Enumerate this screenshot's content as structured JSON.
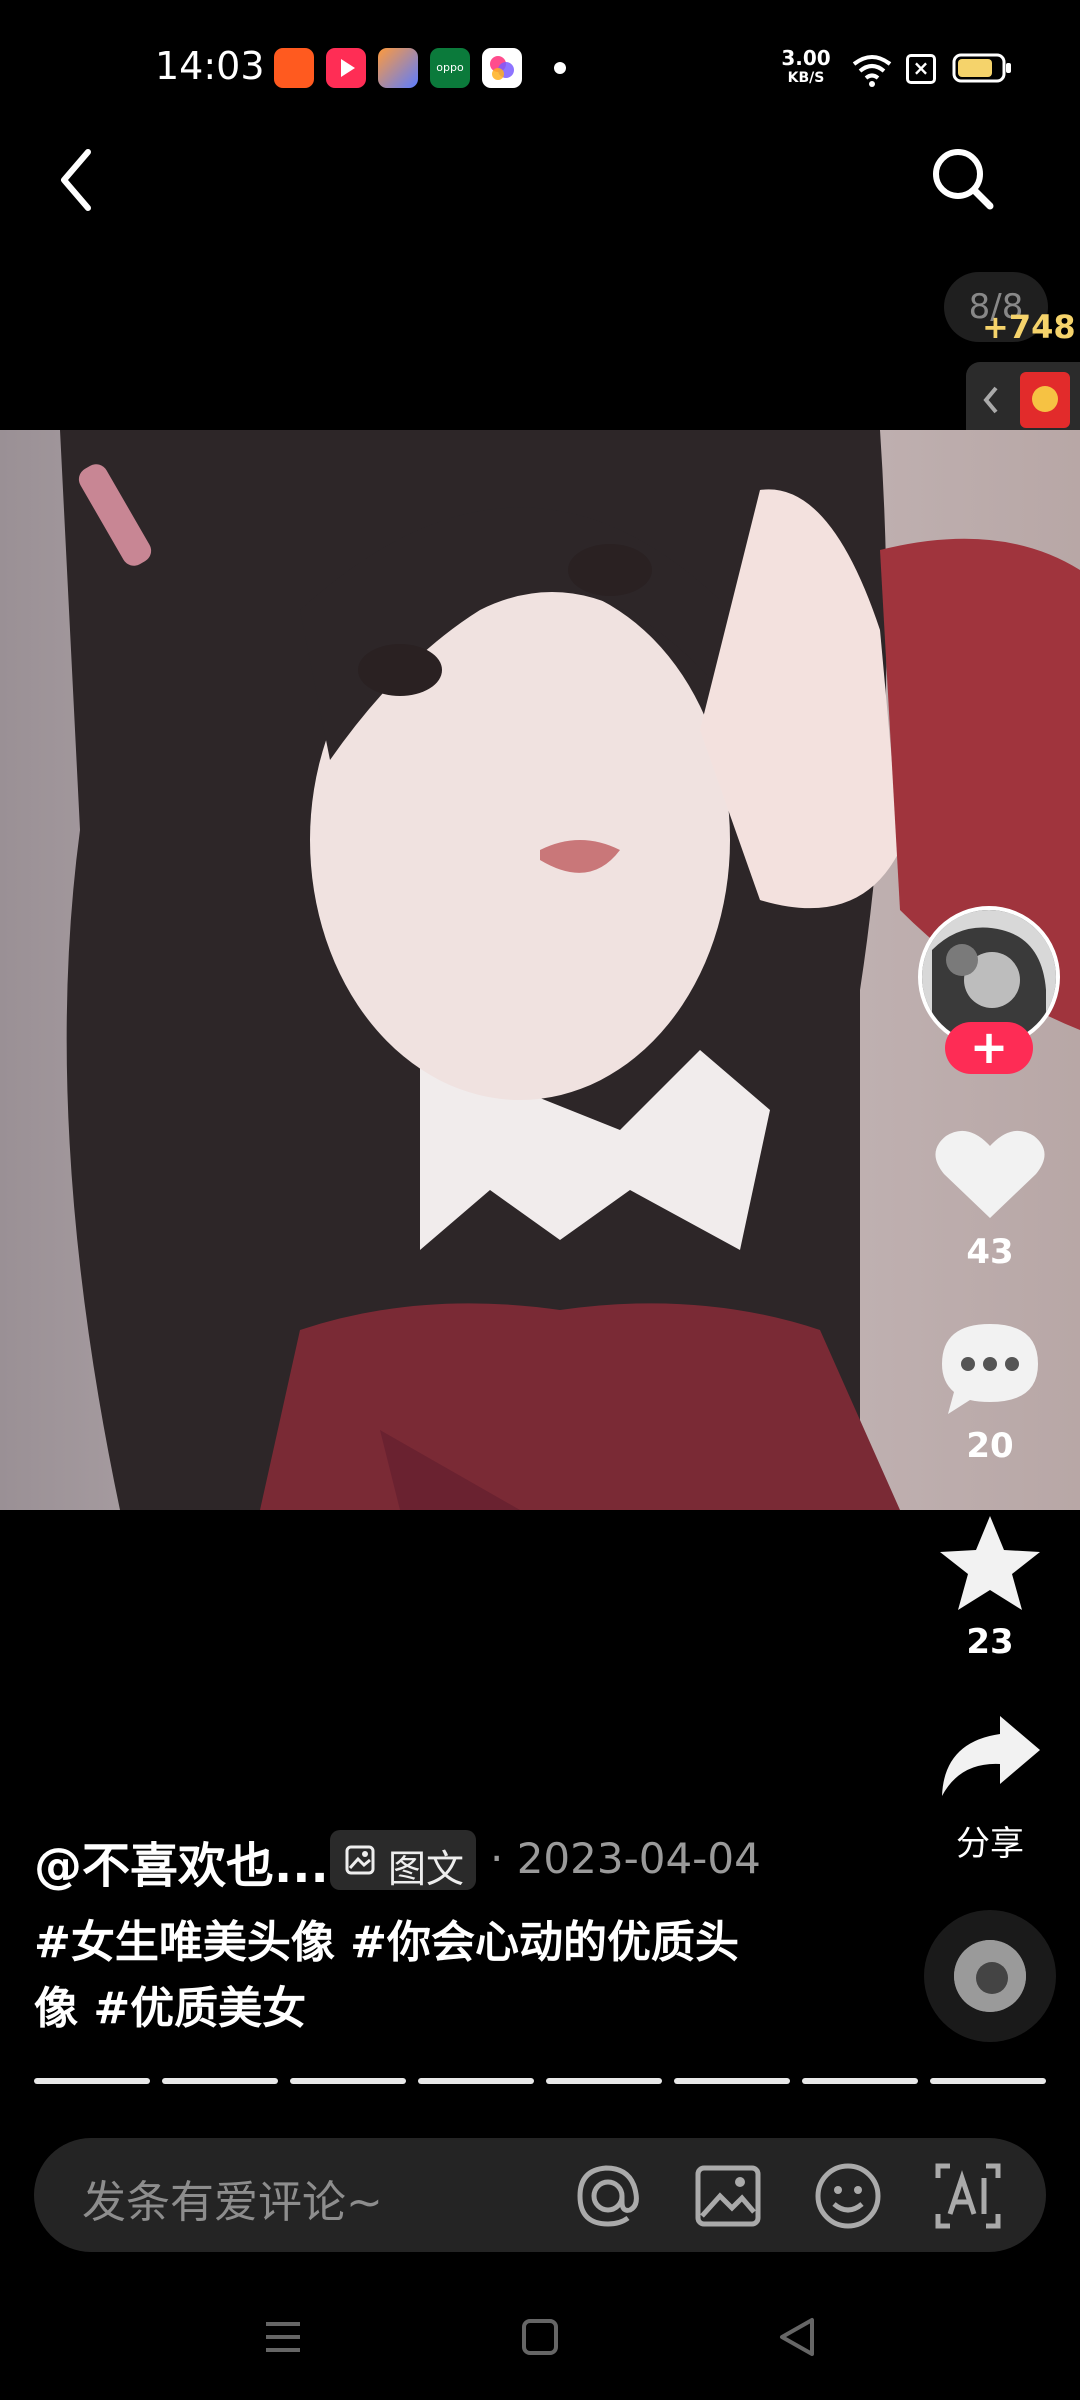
{
  "status_bar": {
    "time": "14:03",
    "apps": [
      {
        "icon": "kuaishou-lite-app-icon",
        "color": "#ff5a1f"
      },
      {
        "icon": "video-play-app-icon",
        "color": "#ff2d55"
      },
      {
        "icon": "toolbox-app-icon",
        "color": "#5b7cff"
      },
      {
        "icon": "oppo-app-icon",
        "color": "#0b7a3b"
      },
      {
        "icon": "assistant-app-icon",
        "color": "#ffffff"
      }
    ],
    "net_speed_value": "3.00",
    "net_speed_unit": "KB/S",
    "battery_color": "#f5d36b"
  },
  "top_nav": {
    "back_icon": "back-chevron-icon",
    "search_icon": "search-icon"
  },
  "page_counter": "8/8",
  "coins": "+748",
  "rail": {
    "like_count": "43",
    "comment_count": "20",
    "favorite_count": "23",
    "share_label": "分享"
  },
  "caption": {
    "author": "@不喜欢也...",
    "post_type": "图文",
    "date": "· 2023-04-04",
    "hashtags_line1": "#女生唯美头像 #你会心动的优质头",
    "hashtags_line2": "像 #优质美女"
  },
  "progress": {
    "segments": 8,
    "current": 8
  },
  "comment_bar": {
    "placeholder": "发条有爱评论~"
  },
  "colors": {
    "accent": "#fe2c55",
    "coin": "#f5d36b"
  }
}
